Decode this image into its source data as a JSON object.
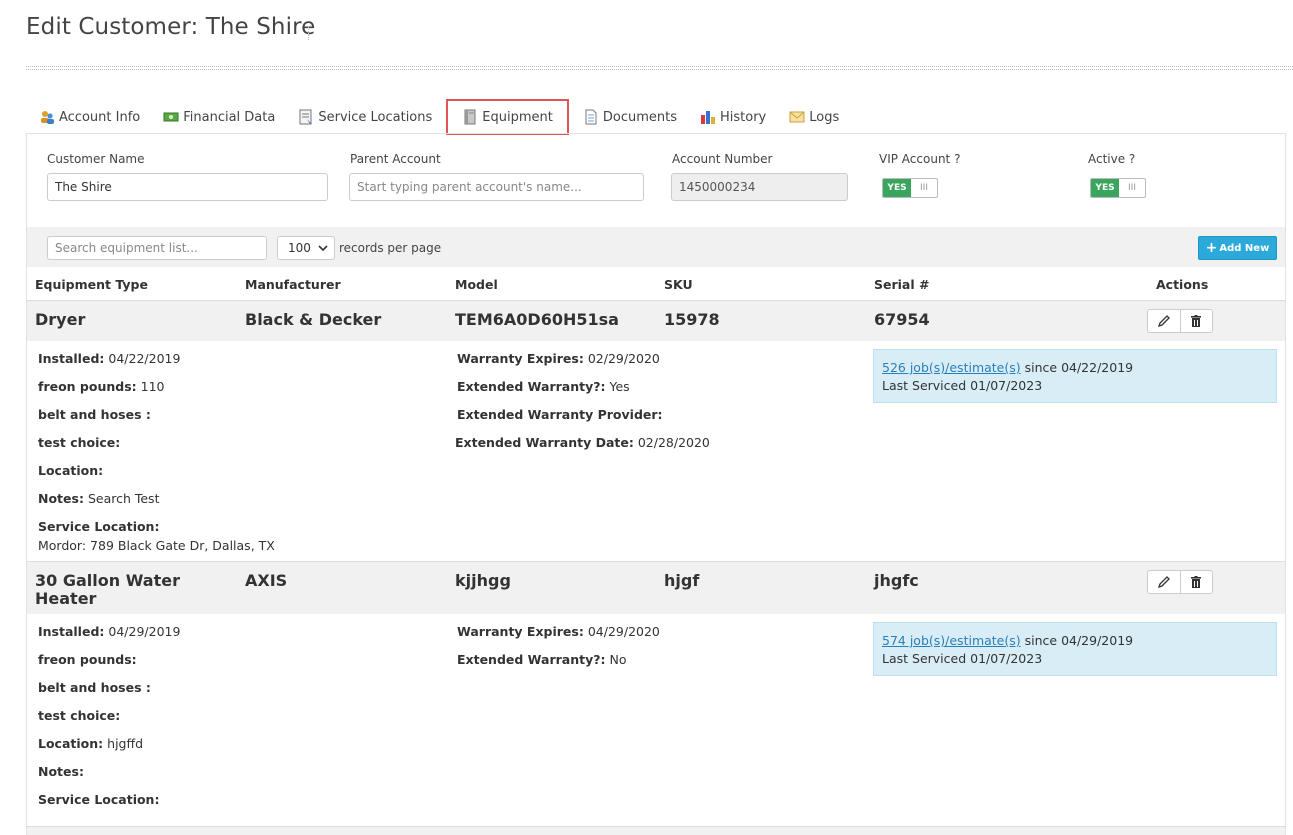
{
  "page": {
    "title": "Edit Customer: The Shire"
  },
  "tabs": [
    {
      "label": "Account Info",
      "icon": "users-icon"
    },
    {
      "label": "Financial Data",
      "icon": "money-icon"
    },
    {
      "label": "Service Locations",
      "icon": "clipboard-icon"
    },
    {
      "label": "Equipment",
      "icon": "book-icon",
      "active": true
    },
    {
      "label": "Documents",
      "icon": "document-icon"
    },
    {
      "label": "History",
      "icon": "bar-chart-icon"
    },
    {
      "label": "Logs",
      "icon": "envelope-icon"
    }
  ],
  "customer": {
    "name_label": "Customer Name",
    "name_value": "The Shire",
    "parent_label": "Parent Account",
    "parent_placeholder": "Start typing parent account's name...",
    "account_number_label": "Account Number",
    "account_number_value": "1450000234",
    "vip_label": "VIP Account ?",
    "vip_toggle": {
      "on_text": "YES",
      "handle_text": "III"
    },
    "active_label": "Active ?",
    "active_toggle": {
      "on_text": "YES",
      "handle_text": "III"
    }
  },
  "toolbar": {
    "search_placeholder": "Search equipment list...",
    "per_page_value": "100",
    "per_page_label": "records per page",
    "add_new_label": "Add New"
  },
  "columns": [
    "Equipment Type",
    "Manufacturer",
    "Model",
    "SKU",
    "Serial #",
    "Actions"
  ],
  "equipment": [
    {
      "type": "Dryer",
      "manufacturer": "Black & Decker",
      "model": "TEM6A0D60H51sa",
      "sku": "15978",
      "serial": "67954",
      "left": [
        {
          "label": "Installed:",
          "value": "04/22/2019"
        },
        {
          "label": "freon pounds:",
          "value": "110"
        },
        {
          "label": "belt and hoses :",
          "value": ""
        },
        {
          "label": "test choice:",
          "value": ""
        },
        {
          "label": "Location:",
          "value": ""
        },
        {
          "label": "Notes:",
          "value": "Search Test"
        },
        {
          "label": "Service Location:",
          "value": ""
        }
      ],
      "service_location_value": "Mordor: 789 Black Gate Dr, Dallas, TX",
      "middle": [
        {
          "label": "Warranty Expires:",
          "value": "02/29/2020"
        },
        {
          "label": "Extended Warranty?:",
          "value": "Yes"
        },
        {
          "label": "Extended Warranty Provider:",
          "value": ""
        },
        {
          "label": "Extended Warranty Date:",
          "value": "02/28/2020"
        }
      ],
      "jobs_link": "526 job(s)/estimate(s)",
      "jobs_since": "since 04/22/2019",
      "last_serviced": "Last Serviced 01/07/2023"
    },
    {
      "type": "30 Gallon Water Heater",
      "type_line1": "30 Gallon Water",
      "type_line2": "Heater",
      "manufacturer": "AXIS",
      "model": "kjjhgg",
      "sku": "hjgf",
      "serial": "jhgfc",
      "left": [
        {
          "label": "Installed:",
          "value": "04/29/2019"
        },
        {
          "label": "freon pounds:",
          "value": ""
        },
        {
          "label": "belt and hoses :",
          "value": ""
        },
        {
          "label": "test choice:",
          "value": ""
        },
        {
          "label": "Location:",
          "value": "hjgffd"
        },
        {
          "label": "Notes:",
          "value": ""
        },
        {
          "label": "Service Location:",
          "value": ""
        }
      ],
      "middle": [
        {
          "label": "Warranty Expires:",
          "value": "04/29/2020"
        },
        {
          "label": "Extended Warranty?:",
          "value": "No"
        }
      ],
      "jobs_link": "574 job(s)/estimate(s)",
      "jobs_since": "since 04/29/2019",
      "last_serviced": "Last Serviced 01/07/2023"
    }
  ]
}
